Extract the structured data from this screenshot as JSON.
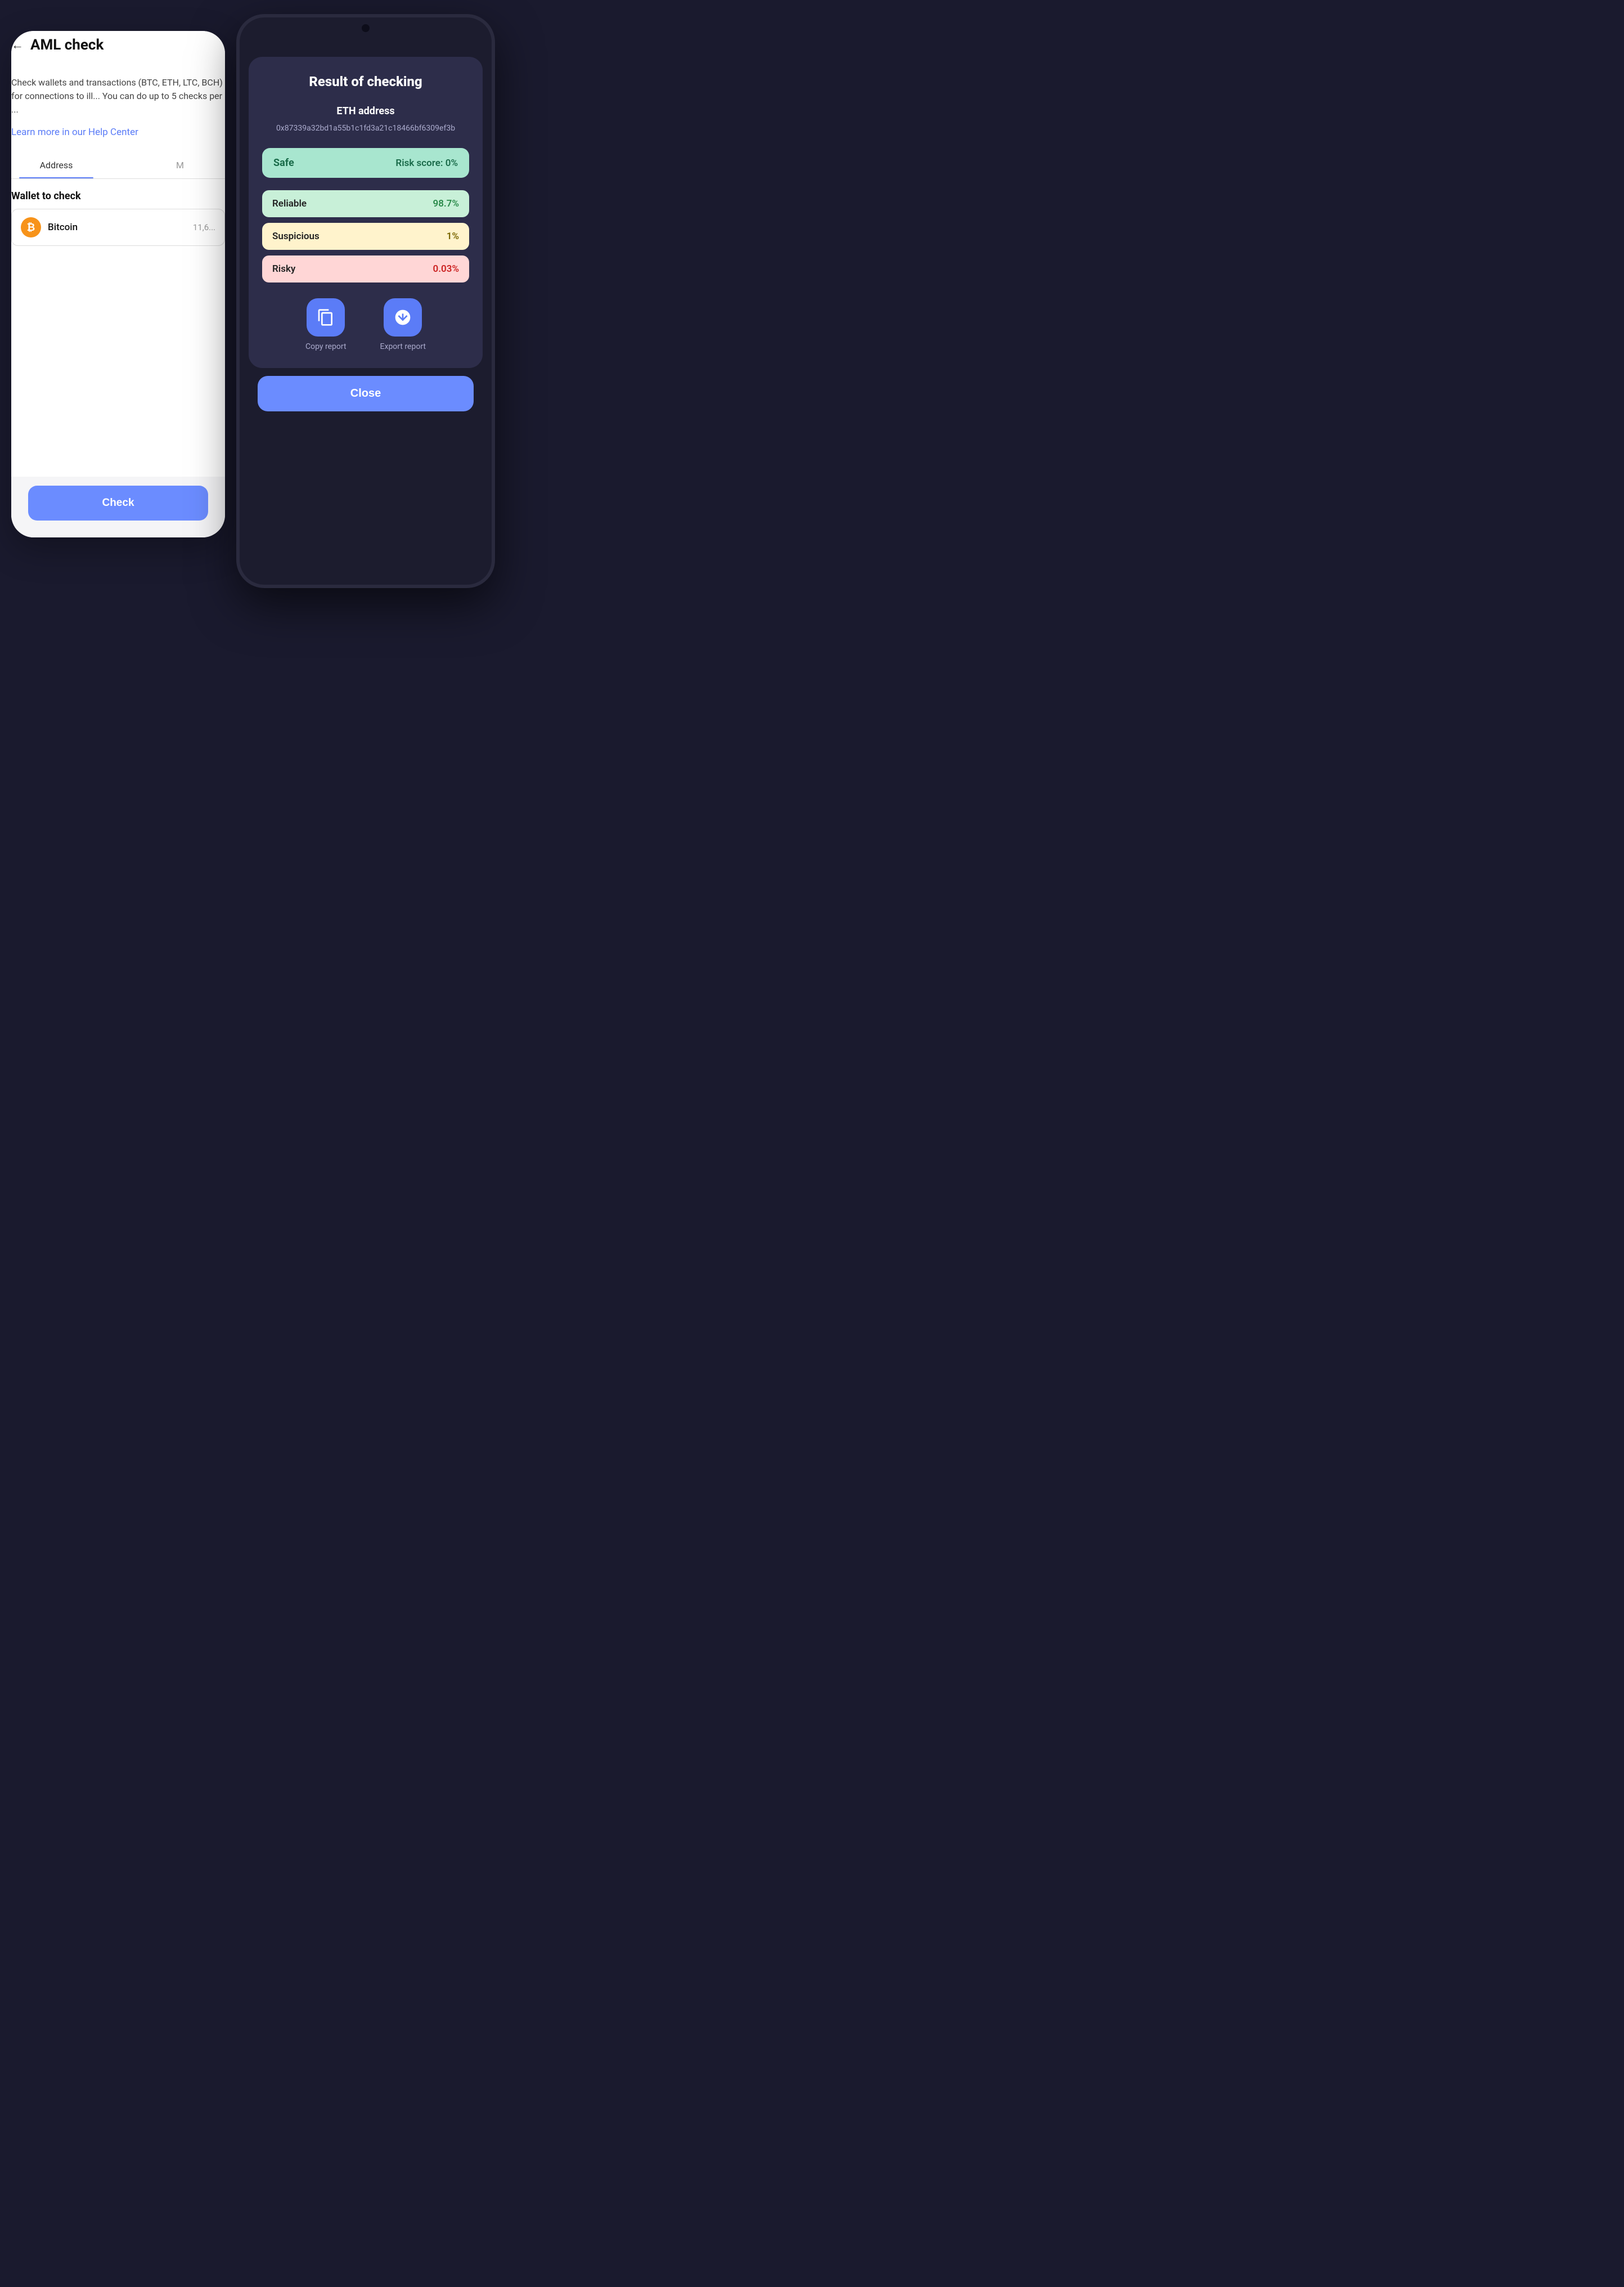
{
  "background_phone": {
    "title": "AML check",
    "back_label": "←",
    "description": "Check wallets and transactions (BTC, ETH, LTC, BCH) for connections to ill... You can do up to 5 checks per ...",
    "help_link": "Learn more in our Help Center",
    "tabs": [
      {
        "label": "Address",
        "active": true
      },
      {
        "label": "M",
        "active": false
      }
    ],
    "wallet_section": {
      "label": "Wallet to check",
      "name": "Bitcoin",
      "amount": "11,6..."
    },
    "check_button": "Check"
  },
  "result_phone": {
    "title": "Result of checking",
    "eth_label": "ETH address",
    "eth_address": "0x87339a32bd1a55b1c1fd3a21c18466bf6309ef3b",
    "safe_badge": {
      "label": "Safe",
      "score_label": "Risk score: 0%"
    },
    "scores": [
      {
        "name": "Reliable",
        "value": "98.7%",
        "type": "reliable"
      },
      {
        "name": "Suspicious",
        "value": "1%",
        "type": "suspicious"
      },
      {
        "name": "Risky",
        "value": "0.03%",
        "type": "risky"
      }
    ],
    "actions": [
      {
        "label": "Copy report",
        "icon": "copy"
      },
      {
        "label": "Export report",
        "icon": "export"
      }
    ],
    "close_button": "Close"
  }
}
